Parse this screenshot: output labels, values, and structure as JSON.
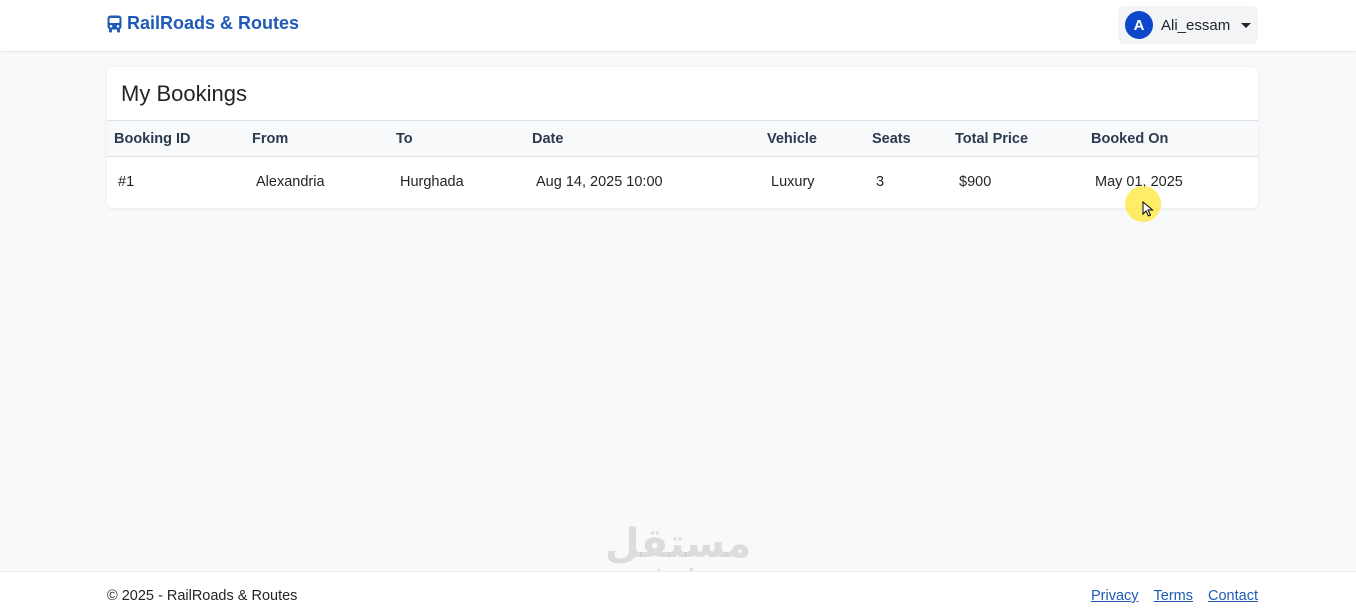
{
  "app": {
    "brand": "RailRoads & Routes",
    "brand_color": "#1f5bb6",
    "brand_icon": "bus-icon"
  },
  "user": {
    "initial": "A",
    "name": "Ali_essam",
    "avatar_color": "#0d47c9"
  },
  "bookings": {
    "title": "My Bookings",
    "columns": [
      "Booking ID",
      "From",
      "To",
      "Date",
      "Vehicle",
      "Seats",
      "Total Price",
      "Booked On"
    ],
    "rows": [
      [
        "#1",
        "Alexandria",
        "Hurghada",
        "Aug 14, 2025 10:00",
        "Luxury",
        "3",
        "$900",
        "May 01, 2025"
      ]
    ]
  },
  "footer": {
    "copyright": "© 2025 - RailRoads & Routes",
    "links": [
      "Privacy",
      "Terms",
      "Contact"
    ]
  },
  "watermark": {
    "arabic": "مستقل",
    "latin": "mostaql.com"
  }
}
